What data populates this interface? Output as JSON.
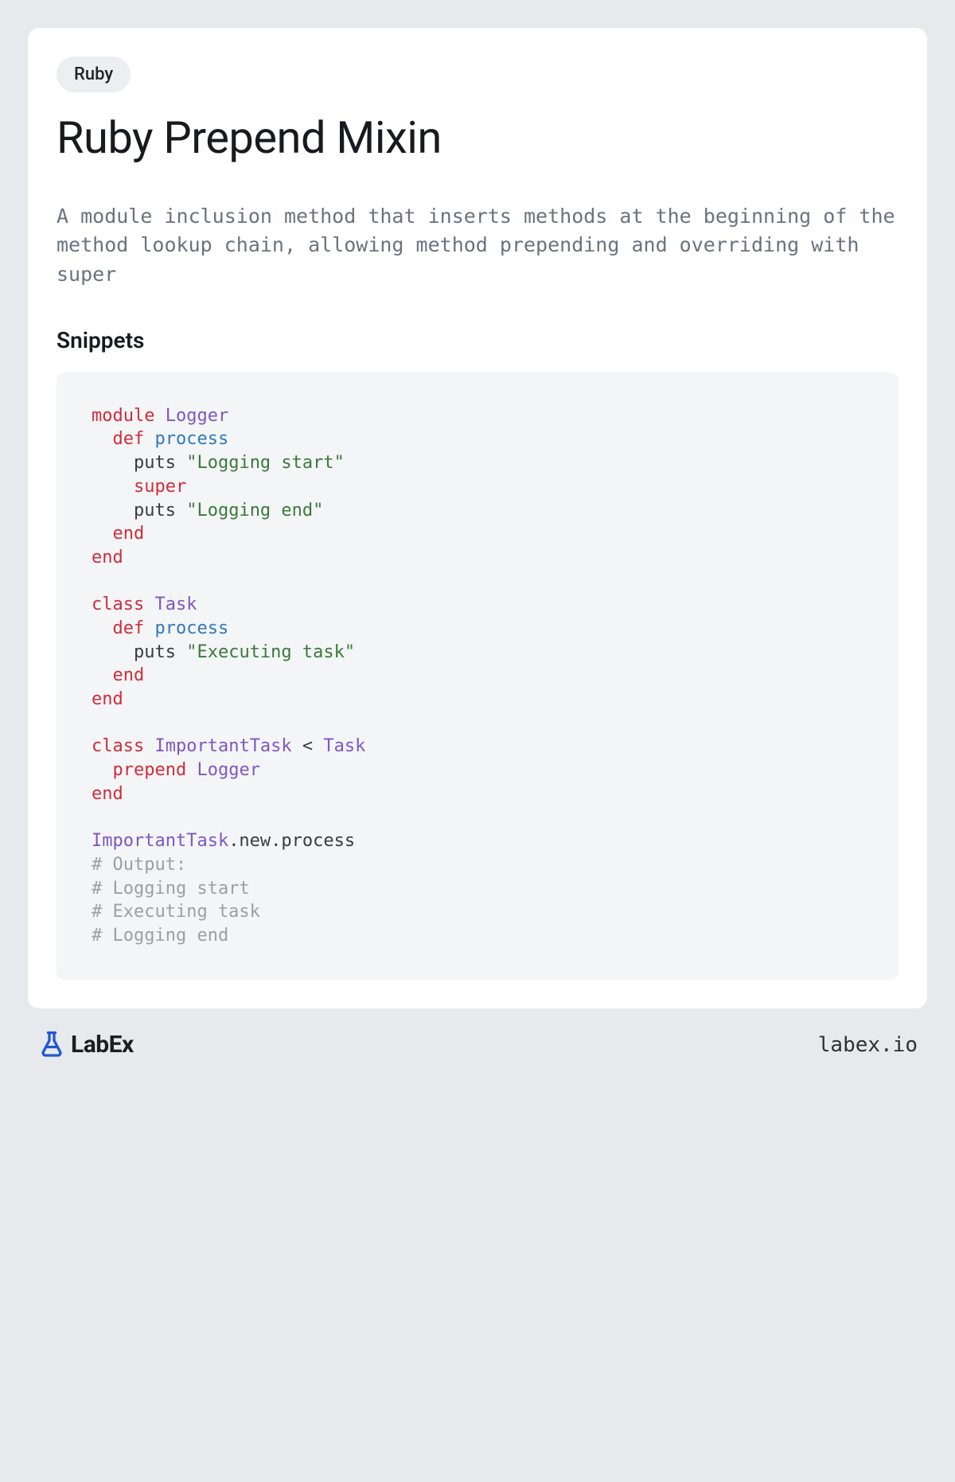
{
  "badge": "Ruby",
  "title": "Ruby Prepend Mixin",
  "description": "A module inclusion method that inserts methods at the beginning of the method lookup chain, allowing method prepending and overriding with super",
  "snippets_heading": "Snippets",
  "code": {
    "tokens": [
      {
        "t": "module",
        "c": "keyword"
      },
      {
        "t": " ",
        "c": "plain"
      },
      {
        "t": "Logger",
        "c": "class"
      },
      {
        "t": "\n",
        "c": "plain"
      },
      {
        "t": "  ",
        "c": "plain"
      },
      {
        "t": "def",
        "c": "keyword"
      },
      {
        "t": " ",
        "c": "plain"
      },
      {
        "t": "process",
        "c": "method"
      },
      {
        "t": "\n",
        "c": "plain"
      },
      {
        "t": "    puts ",
        "c": "plain"
      },
      {
        "t": "\"Logging start\"",
        "c": "string"
      },
      {
        "t": "\n",
        "c": "plain"
      },
      {
        "t": "    ",
        "c": "plain"
      },
      {
        "t": "super",
        "c": "keyword"
      },
      {
        "t": "\n",
        "c": "plain"
      },
      {
        "t": "    puts ",
        "c": "plain"
      },
      {
        "t": "\"Logging end\"",
        "c": "string"
      },
      {
        "t": "\n",
        "c": "plain"
      },
      {
        "t": "  ",
        "c": "plain"
      },
      {
        "t": "end",
        "c": "keyword"
      },
      {
        "t": "\n",
        "c": "plain"
      },
      {
        "t": "end",
        "c": "keyword"
      },
      {
        "t": "\n",
        "c": "plain"
      },
      {
        "t": "\n",
        "c": "plain"
      },
      {
        "t": "class",
        "c": "keyword"
      },
      {
        "t": " ",
        "c": "plain"
      },
      {
        "t": "Task",
        "c": "class"
      },
      {
        "t": "\n",
        "c": "plain"
      },
      {
        "t": "  ",
        "c": "plain"
      },
      {
        "t": "def",
        "c": "keyword"
      },
      {
        "t": " ",
        "c": "plain"
      },
      {
        "t": "process",
        "c": "method"
      },
      {
        "t": "\n",
        "c": "plain"
      },
      {
        "t": "    puts ",
        "c": "plain"
      },
      {
        "t": "\"Executing task\"",
        "c": "string"
      },
      {
        "t": "\n",
        "c": "plain"
      },
      {
        "t": "  ",
        "c": "plain"
      },
      {
        "t": "end",
        "c": "keyword"
      },
      {
        "t": "\n",
        "c": "plain"
      },
      {
        "t": "end",
        "c": "keyword"
      },
      {
        "t": "\n",
        "c": "plain"
      },
      {
        "t": "\n",
        "c": "plain"
      },
      {
        "t": "class",
        "c": "keyword"
      },
      {
        "t": " ",
        "c": "plain"
      },
      {
        "t": "ImportantTask",
        "c": "class"
      },
      {
        "t": " < ",
        "c": "plain"
      },
      {
        "t": "Task",
        "c": "class"
      },
      {
        "t": "\n",
        "c": "plain"
      },
      {
        "t": "  ",
        "c": "plain"
      },
      {
        "t": "prepend",
        "c": "keyword"
      },
      {
        "t": " ",
        "c": "plain"
      },
      {
        "t": "Logger",
        "c": "class"
      },
      {
        "t": "\n",
        "c": "plain"
      },
      {
        "t": "end",
        "c": "keyword"
      },
      {
        "t": "\n",
        "c": "plain"
      },
      {
        "t": "\n",
        "c": "plain"
      },
      {
        "t": "ImportantTask",
        "c": "class"
      },
      {
        "t": ".new.process\n",
        "c": "plain"
      },
      {
        "t": "# Output:\n",
        "c": "comment"
      },
      {
        "t": "# Logging start\n",
        "c": "comment"
      },
      {
        "t": "# Executing task\n",
        "c": "comment"
      },
      {
        "t": "# Logging end",
        "c": "comment"
      }
    ]
  },
  "footer": {
    "brand": "LabEx",
    "url": "labex.io"
  }
}
